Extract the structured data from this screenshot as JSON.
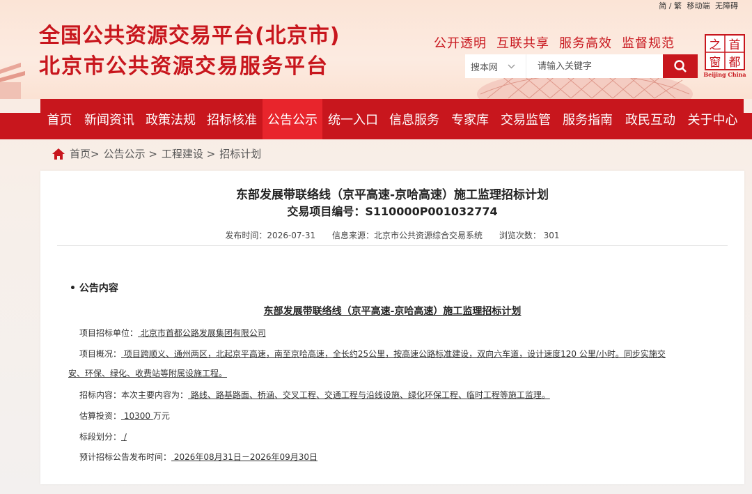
{
  "util": {
    "lang": "简 / 繁",
    "mobile": "移动端",
    "accessibility": "无障碍"
  },
  "header": {
    "title_line1": "全国公共资源交易平台(北京市)",
    "title_line2": "北京市公共资源交易服务平台",
    "slogans": [
      "公开透明",
      "互联共享",
      "服务高效",
      "监督规范"
    ],
    "logo_chars": [
      "之",
      "首",
      "窗",
      "都"
    ],
    "logo_caption": "Beijing China"
  },
  "search": {
    "scope": "搜本网",
    "placeholder": "请输入关键字"
  },
  "nav": {
    "items": [
      "首页",
      "新闻资讯",
      "政策法规",
      "招标核准",
      "公告公示",
      "统一入口",
      "信息服务",
      "专家库",
      "交易监管",
      "服务指南",
      "政民互动",
      "关于中心"
    ],
    "active_index": 4
  },
  "breadcrumb": {
    "home": "首页>",
    "c1": "公告公示 >",
    "c2": "工程建设 >",
    "c3": "招标计划"
  },
  "article": {
    "title": "东部发展带联络线（京平高速-京哈高速）施工监理招标计划",
    "subtitle": "交易项目编号：S110000P001032774",
    "publish_time": "发布时间：2026-07-31",
    "source": "信息来源：北京市公共资源综合交易系统",
    "views": "浏览次数：  301",
    "section_label": "• 公告内容",
    "doc_title": "东部发展带联络线（京平高速-京哈高速）施工监理招标计划",
    "unit_label": "项目招标单位：",
    "unit_value": "  北京市首都公路发展集团有限公司  ",
    "overview_label": "项目概况：",
    "overview_line1": "  项目跨顺义、通州两区，北起京平高速，南至京哈高速，全长约25公里，按高速公路标准建设，双向六车道，设计速度120 公里/小时。同步实施交",
    "overview_line2": "安、环保、绿化、收费站等附属设施工程。   ",
    "content_label": "招标内容：本次主要内容为：",
    "content_value": "  路线、路基路面、桥涵、交叉工程、交通工程与沿线设施、绿化环保工程、临时工程等施工监理。   ",
    "investment_label": "估算投资：",
    "investment_value": "  10300  ",
    "investment_unit": "万元",
    "section_div_label": "标段划分：",
    "section_div_value": "  /  ",
    "pubtime_label": "预计招标公告发布时间：",
    "pubtime_value": "  2026年08月31日－2026年09月30日  "
  },
  "colors": {
    "brand_red": "#c8161d",
    "nav_active": "#e8252c"
  }
}
